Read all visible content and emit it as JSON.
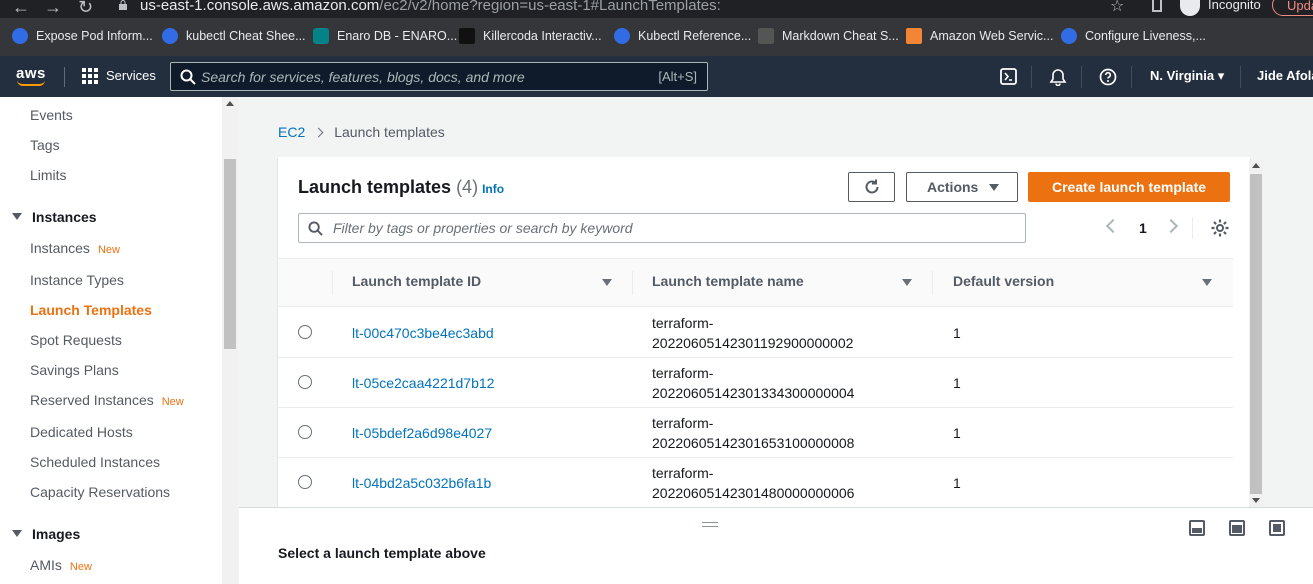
{
  "browser": {
    "url_host": "us-east-1.console.aws.amazon.com",
    "url_path": "/ec2/v2/home?region=us-east-1#LaunchTemplates:",
    "profile_label": "Incognito",
    "update_label": "Upda"
  },
  "bookmarks": [
    {
      "label": "Expose Pod Inform...",
      "icon": "kubernetes-icon",
      "color": "#326ce5"
    },
    {
      "label": "kubectl Cheat Shee...",
      "icon": "kubernetes-icon",
      "color": "#326ce5"
    },
    {
      "label": "Enaro DB - ENARO...",
      "icon": "sharepoint-icon",
      "color": "#038387"
    },
    {
      "label": "Killercoda Interactiv...",
      "icon": "killercoda-icon",
      "color": "#111111"
    },
    {
      "label": "Kubectl Reference...",
      "icon": "kubernetes-icon",
      "color": "#326ce5"
    },
    {
      "label": "Markdown Cheat S...",
      "icon": "github-icon",
      "color": "#555555"
    },
    {
      "label": "Amazon Web Servic...",
      "icon": "aws-box-icon",
      "color": "#f58536"
    },
    {
      "label": "Configure Liveness,...",
      "icon": "kubernetes-icon",
      "color": "#326ce5"
    }
  ],
  "awsnav": {
    "logo": "aws",
    "services_label": "Services",
    "search_placeholder": "Search for services, features, blogs, docs, and more",
    "search_shortcut": "[Alt+S]",
    "region_label": "N. Virginia",
    "user_label": "Jide Afolay"
  },
  "sidebar": {
    "top_items": [
      {
        "label": "Events"
      },
      {
        "label": "Tags"
      },
      {
        "label": "Limits"
      }
    ],
    "instances_header": "Instances",
    "instances_items": [
      {
        "label": "Instances",
        "badge": "New"
      },
      {
        "label": "Instance Types",
        "badge": ""
      },
      {
        "label": "Launch Templates",
        "badge": ""
      },
      {
        "label": "Spot Requests",
        "badge": ""
      },
      {
        "label": "Savings Plans",
        "badge": ""
      },
      {
        "label": "Reserved Instances",
        "badge": "New"
      },
      {
        "label": "Dedicated Hosts",
        "badge": ""
      },
      {
        "label": "Scheduled Instances",
        "badge": ""
      },
      {
        "label": "Capacity Reservations",
        "badge": ""
      }
    ],
    "images_header": "Images",
    "images_items": [
      {
        "label": "AMIs",
        "badge": "New"
      }
    ],
    "active_label": "Launch Templates"
  },
  "breadcrumb": {
    "root": "EC2",
    "current": "Launch templates"
  },
  "panel": {
    "title": "Launch templates",
    "count": "(4)",
    "info_label": "Info",
    "actions_label": "Actions",
    "create_label": "Create launch template",
    "filter_placeholder": "Filter by tags or properties or search by keyword",
    "page_number": "1"
  },
  "table": {
    "columns": [
      "Launch template ID",
      "Launch template name",
      "Default version"
    ],
    "rows": [
      {
        "id": "lt-00c470c3be4ec3abd",
        "name_line1": "terraform-",
        "name_line2": "20220605142301192900000002",
        "version": "1"
      },
      {
        "id": "lt-05ce2caa4221d7b12",
        "name_line1": "terraform-",
        "name_line2": "20220605142301334300000004",
        "version": "1"
      },
      {
        "id": "lt-05bdef2a6d98e4027",
        "name_line1": "terraform-",
        "name_line2": "20220605142301653100000008",
        "version": "1"
      },
      {
        "id": "lt-04bd2a5c032b6fa1b",
        "name_line1": "terraform-",
        "name_line2": "20220605142301480000000006",
        "version": "1"
      }
    ]
  },
  "split_panel": {
    "message": "Select a launch template above"
  },
  "colors": {
    "accent": "#ec7211",
    "link": "#0073bb",
    "nav_bg": "#232f3e"
  }
}
